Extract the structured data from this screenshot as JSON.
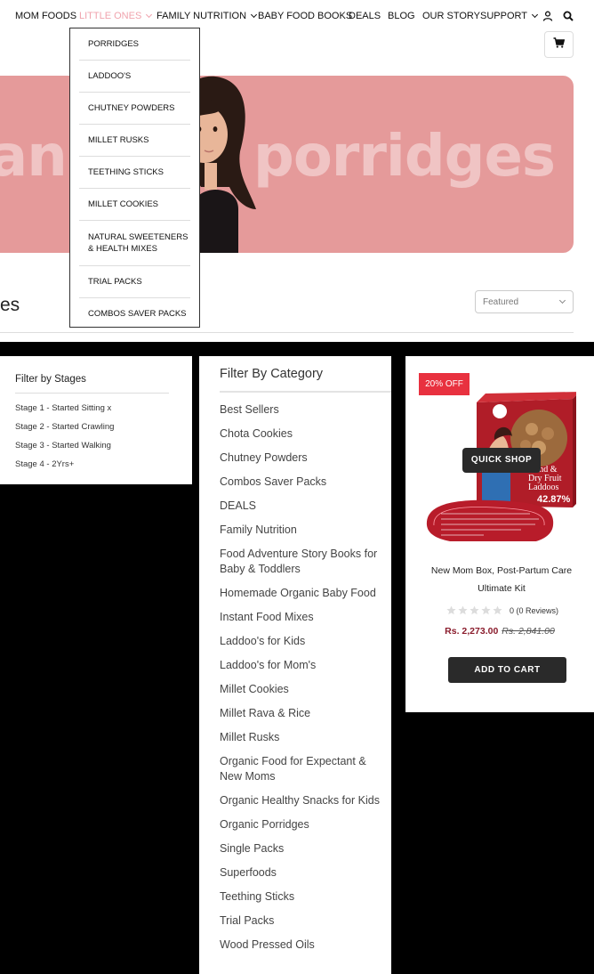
{
  "nav": {
    "items": [
      "MOM FOODS",
      "LITTLE ONES",
      "FAMILY NUTRITION",
      "BABY FOOD BOOKS",
      "DEALS",
      "BLOG",
      "OUR STORY",
      "SUPPORT"
    ],
    "active": "LITTLE ONES",
    "icons": [
      "user-icon",
      "search-icon",
      "cart-icon"
    ]
  },
  "dropdown": {
    "items": [
      "PORRIDGES",
      "LADDOO'S",
      "CHUTNEY POWDERS",
      "MILLET RUSKS",
      "TEETHING STICKS",
      "MILLET COOKIES",
      "NATURAL SWEETENERS & HEALTH MIXES",
      "TRIAL PACKS",
      "COMBOS SAVER PACKS"
    ]
  },
  "banner": {
    "text_left": "an",
    "text_right": "porridges",
    "bg_color": "#e59a9a"
  },
  "page": {
    "title": "es",
    "sort_value": "Featured"
  },
  "stages": {
    "heading": "Filter by Stages",
    "items": [
      "Stage 1 - Started Sitting x",
      "Stage 2 - Started Crawling",
      "Stage 3 - Started Walking",
      "Stage 4 - 2Yrs+"
    ]
  },
  "categories": {
    "heading": "Filter By Category",
    "items": [
      "Best Sellers",
      "Chota Cookies",
      "Chutney Powders",
      "Combos Saver Packs",
      "DEALS",
      "Family Nutrition",
      "Food Adventure Story Books for Baby & Toddlers",
      "Homemade Organic Baby Food",
      "Instant Food Mixes",
      "Laddoo's for Kids",
      "Laddoo's for Mom's",
      "Millet Cookies",
      "Millet Rava & Rice",
      "Millet Rusks",
      "Organic Food for Expectant & New Moms",
      "Organic Healthy Snacks for Kids",
      "Organic Porridges",
      "Single Packs",
      "Superfoods",
      "Teething Sticks",
      "Trial Packs",
      "Wood Pressed Oils"
    ]
  },
  "product": {
    "badge": "20% OFF",
    "quick_shop": "QUICK SHOP",
    "name": "New Mom Box, Post-Partum Care Ultimate Kit",
    "rating": 0,
    "reviews": "0 (0 Reviews)",
    "price": "Rs. 2,273.00",
    "compare_price": "Rs. 2,841.00",
    "add_to_cart": "ADD TO CART",
    "package_text": [
      "Gond &",
      "Dry Fruit",
      "Laddoos"
    ],
    "package_percent": "42.87%"
  },
  "colors": {
    "accent_pink": "#f0a3ad",
    "sale_red": "#e8313f",
    "price_color": "#8a1c2c",
    "button_dark": "#2a2a2a"
  }
}
